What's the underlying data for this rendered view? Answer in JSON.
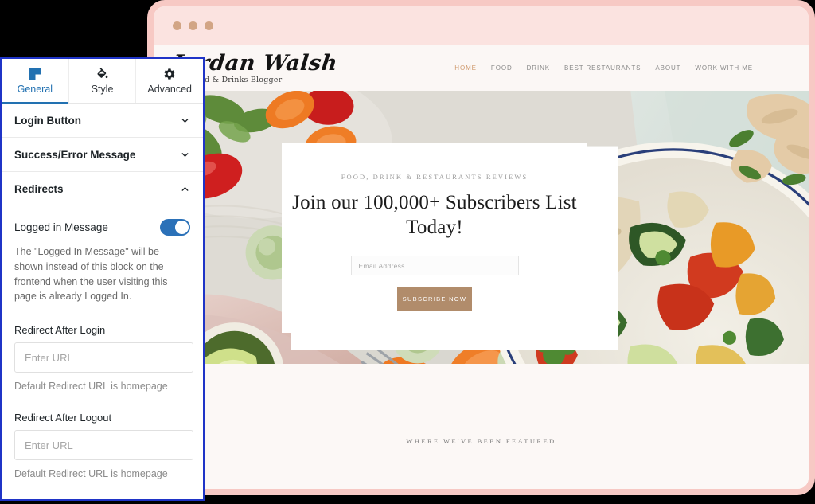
{
  "browser": {
    "dots_count": 3,
    "dot_color": "#d2a585",
    "frame_color": "#f7c9c4",
    "chrome_color": "#fbe3e0"
  },
  "site": {
    "logo": {
      "name": "Jordan Walsh",
      "tagline": "Food & Drinks Blogger"
    },
    "nav": [
      {
        "label": "HOME",
        "active": true
      },
      {
        "label": "FOOD",
        "active": false
      },
      {
        "label": "DRINK",
        "active": false
      },
      {
        "label": "BEST RESTAURANTS",
        "active": false
      },
      {
        "label": "ABOUT",
        "active": false
      },
      {
        "label": "WORK WITH ME",
        "active": false
      }
    ],
    "cta": {
      "eyebrow": "FOOD, DRINK & RESTAURANTS REVIEWS",
      "title": "Join our 100,000+ Subscribers List Today!",
      "email_placeholder": "Email Address",
      "email_value": "",
      "button_label": "SUBSCRIBE NOW",
      "button_color": "#b18c6b"
    },
    "featured": {
      "heading": "WHERE WE'VE BEEN FEATURED"
    },
    "hero_image_alt": "overhead photo of roasted vegetable quinoa bowl with tomatoes, carrots, brussels sprouts, lime and ginger root"
  },
  "panel": {
    "accent_color": "#2271b1",
    "border_color": "#1f34c7",
    "tabs": [
      {
        "label": "General",
        "icon": "block-icon",
        "active": true
      },
      {
        "label": "Style",
        "icon": "paint-bucket-icon",
        "active": false
      },
      {
        "label": "Advanced",
        "icon": "gear-icon",
        "active": false
      }
    ],
    "sections": [
      {
        "title": "Login Button",
        "expanded": false,
        "chevron": "chevron-down-icon"
      },
      {
        "title": "Success/Error Message",
        "expanded": false,
        "chevron": "chevron-down-icon"
      },
      {
        "title": "Redirects",
        "expanded": true,
        "chevron": "chevron-up-icon"
      }
    ],
    "redirects": {
      "logged_in_message": {
        "label": "Logged in Message",
        "enabled": true,
        "help": "The \"Logged In Message\" will be shown instead of this block on the frontend when the user visiting this page is already Logged In."
      },
      "after_login": {
        "label": "Redirect After Login",
        "placeholder": "Enter URL",
        "value": "",
        "hint": "Default Redirect URL is homepage"
      },
      "after_logout": {
        "label": "Redirect After Logout",
        "placeholder": "Enter URL",
        "value": "",
        "hint": "Default Redirect URL is homepage"
      }
    }
  }
}
